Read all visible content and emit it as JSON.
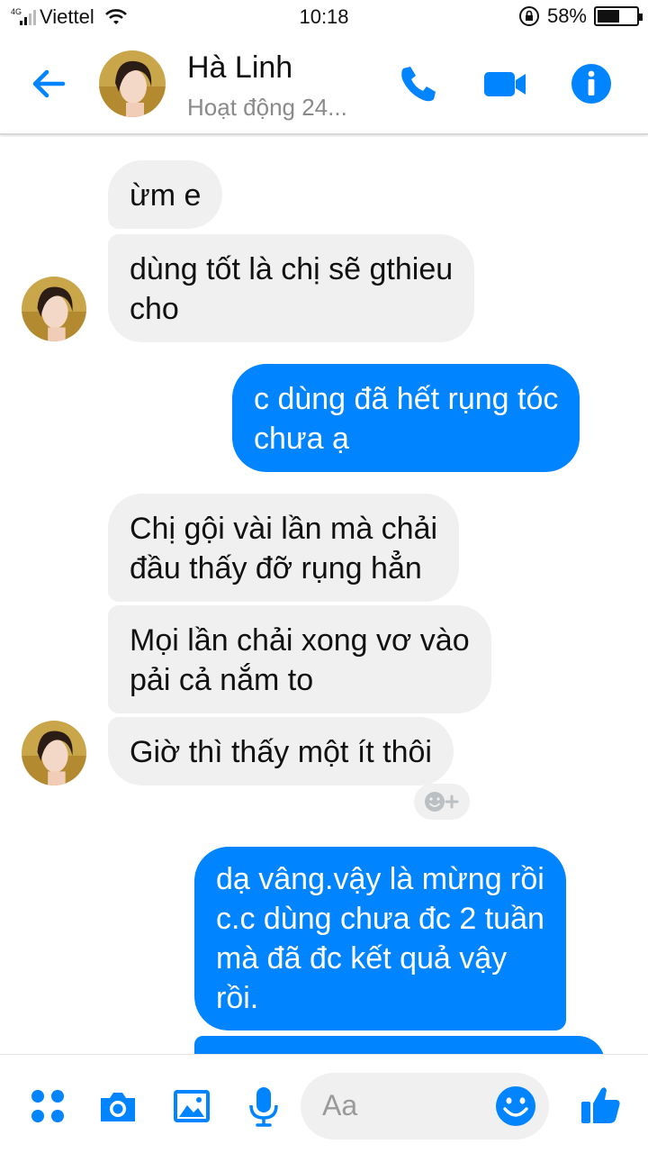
{
  "status_bar": {
    "network": "4G",
    "carrier": "Viettel",
    "time": "10:18",
    "battery_percent_label": "58%",
    "battery_level": 0.58
  },
  "header": {
    "contact_name": "Hà Linh",
    "contact_status": "Hoạt động 24..."
  },
  "colors": {
    "accent": "#0084ff",
    "incoming_bubble": "#f0f0f0",
    "outgoing_text": "#ffffff"
  },
  "messages": [
    {
      "from": "them",
      "lines": [
        "ừm e"
      ]
    },
    {
      "from": "them",
      "lines": [
        "dùng tốt là chị sẽ gthieu",
        "cho"
      ]
    },
    {
      "from": "me",
      "lines": [
        "c dùng đã hết rụng tóc",
        "chưa ạ"
      ]
    },
    {
      "from": "them",
      "lines": [
        "Chị gội vài lần mà chải",
        "đầu thấy đỡ rụng hẳn"
      ]
    },
    {
      "from": "them",
      "lines": [
        "Mọi lần chải xong vơ vào",
        "pải cả nắm to"
      ]
    },
    {
      "from": "them",
      "lines": [
        "Giờ thì thấy một ít thôi"
      ]
    },
    {
      "from": "me",
      "lines": [
        "dạ vâng.vậy là mừng rồi",
        "c.c dùng chưa đc 2 tuần",
        "mà đã đc kết quả vậy",
        "rồi."
      ]
    }
  ],
  "composer": {
    "placeholder": "Aa"
  },
  "icons": {
    "back": "arrow-left-icon",
    "call": "phone-icon",
    "video": "video-camera-icon",
    "info": "info-icon",
    "apps": "four-dots-icon",
    "camera": "camera-icon",
    "gallery": "image-icon",
    "voice": "microphone-icon",
    "emoji": "smiley-icon",
    "like": "thumbs-up-icon",
    "reaction": "add-reaction-icon"
  }
}
